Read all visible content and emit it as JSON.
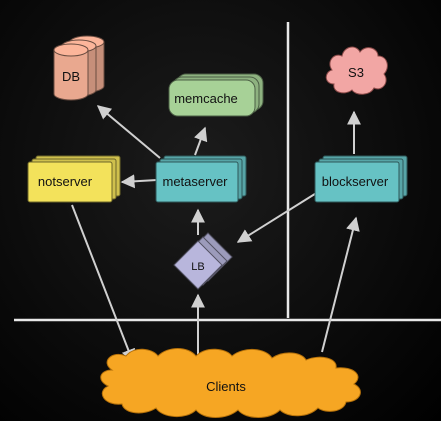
{
  "diagram": {
    "nodes": {
      "db": {
        "label": "DB",
        "color": "#e9a88f"
      },
      "memcache": {
        "label": "memcache",
        "color": "#a7d197"
      },
      "s3": {
        "label": "S3",
        "color": "#f2a6a4"
      },
      "notserver": {
        "label": "notserver",
        "color": "#f3e25b"
      },
      "metaserver": {
        "label": "metaserver",
        "color": "#66c2c4"
      },
      "blockserver": {
        "label": "blockserver",
        "color": "#66c2c4"
      },
      "lb": {
        "label": "LB",
        "color": "#b8b6dc"
      },
      "clients": {
        "label": "Clients",
        "color": "#f6a623"
      }
    },
    "colors": {
      "line": "#e8e8e8",
      "arrow": "#d0d0d0"
    }
  }
}
